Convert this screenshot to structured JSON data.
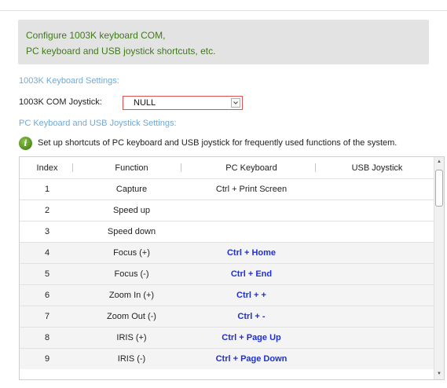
{
  "header": {
    "line1": "Configure 1003K keyboard COM,",
    "line2": "PC keyboard and USB joystick shortcuts, etc."
  },
  "keyboard_settings": {
    "title": "1003K Keyboard Settings:",
    "com_joystick_label": "1003K COM Joystick:",
    "com_joystick_value": "NULL"
  },
  "pc_usb_settings": {
    "title": "PC Keyboard and USB Joystick Settings:",
    "info_text": "Set up shortcuts of PC keyboard and USB joystick for frequently used functions of the system."
  },
  "table": {
    "columns": [
      "Index",
      "Function",
      "PC Keyboard",
      "USB Joystick"
    ],
    "rows": [
      {
        "index": "1",
        "function": "Capture",
        "pc_keyboard": "Ctrl + Print Screen",
        "usb_joystick": "",
        "highlight": false
      },
      {
        "index": "2",
        "function": "Speed up",
        "pc_keyboard": "",
        "usb_joystick": "",
        "highlight": false
      },
      {
        "index": "3",
        "function": "Speed down",
        "pc_keyboard": "",
        "usb_joystick": "",
        "highlight": false
      },
      {
        "index": "4",
        "function": "Focus (+)",
        "pc_keyboard": "Ctrl + Home",
        "usb_joystick": "",
        "highlight": true
      },
      {
        "index": "5",
        "function": "Focus (-)",
        "pc_keyboard": "Ctrl + End",
        "usb_joystick": "",
        "highlight": true
      },
      {
        "index": "6",
        "function": "Zoom In (+)",
        "pc_keyboard": "Ctrl + +",
        "usb_joystick": "",
        "highlight": true
      },
      {
        "index": "7",
        "function": "Zoom Out (-)",
        "pc_keyboard": "Ctrl + -",
        "usb_joystick": "",
        "highlight": true
      },
      {
        "index": "8",
        "function": "IRIS (+)",
        "pc_keyboard": "Ctrl + Page Up",
        "usb_joystick": "",
        "highlight": true
      },
      {
        "index": "9",
        "function": "IRIS (-)",
        "pc_keyboard": "Ctrl + Page Down",
        "usb_joystick": "",
        "highlight": true
      }
    ]
  },
  "icons": {
    "info": "info-icon",
    "dropdown": "chevron-down-icon",
    "scroll_up": "scroll-up-arrow",
    "scroll_down": "scroll-down-arrow"
  },
  "colors": {
    "header_bg": "#e3e3e3",
    "header_text": "#3f7a1a",
    "section_title": "#71a9d8",
    "select_border": "#e05050",
    "shortcut_text": "#1f2fd6",
    "alt_row_bg": "#f4f4f4"
  }
}
